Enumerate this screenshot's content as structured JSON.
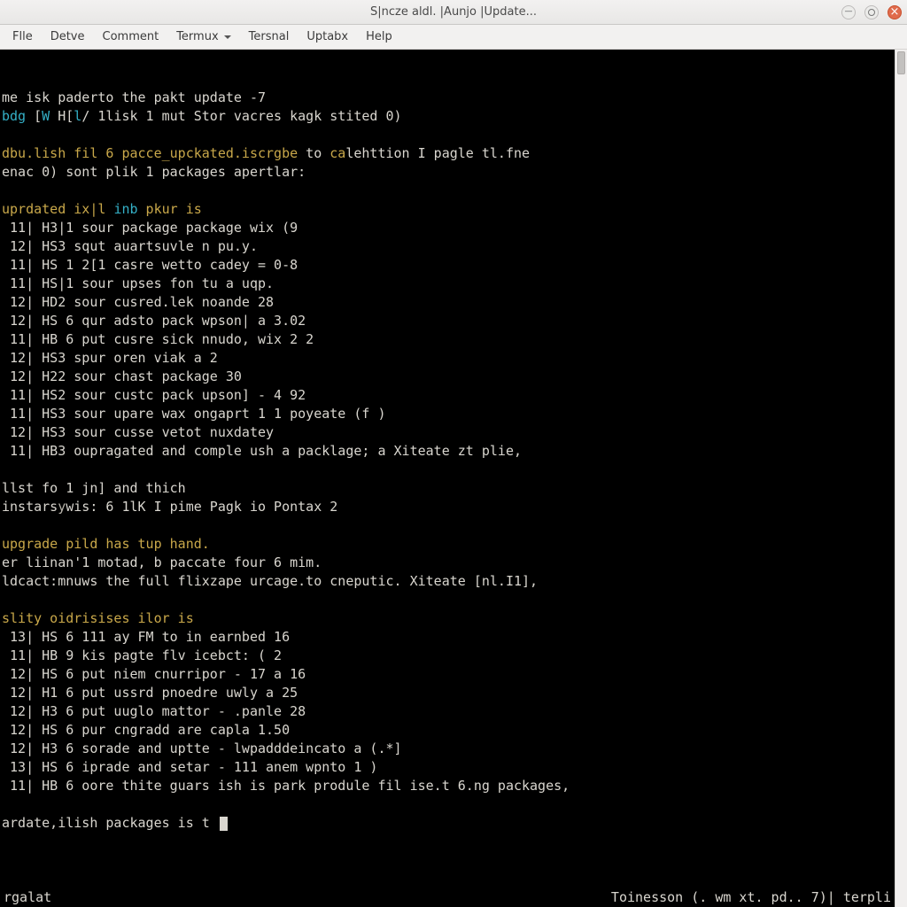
{
  "window": {
    "title": "S|ncze aldl. |Aunjo |Update..."
  },
  "menubar": {
    "items": [
      {
        "label": "Flle",
        "caret": false
      },
      {
        "label": "Detve",
        "caret": false
      },
      {
        "label": "Comment",
        "caret": false
      },
      {
        "label": "Termux",
        "caret": true
      },
      {
        "label": "Tersnal",
        "caret": false
      },
      {
        "label": "Uptabx",
        "caret": false
      },
      {
        "label": "Help",
        "caret": false
      }
    ]
  },
  "terminal": {
    "lines": [
      {
        "segs": [
          {
            "t": "me isk paderto the pakt update -7"
          }
        ]
      },
      {
        "segs": [
          {
            "t": "bdg ",
            "cls": "c-cyan"
          },
          {
            "t": "["
          },
          {
            "t": "W",
            "cls": "c-cyan"
          },
          {
            "t": " H["
          },
          {
            "t": "l",
            "cls": "c-cyan"
          },
          {
            "t": "/ 1lisk 1 mut Stor vacres kagk stited 0)"
          }
        ]
      },
      {
        "segs": [
          {
            "t": ""
          }
        ]
      },
      {
        "segs": [
          {
            "t": "dbu.lish fil 6 pacce_upckated.iscrgbe",
            "cls": "c-yellow"
          },
          {
            "t": " to "
          },
          {
            "t": "ca",
            "cls": "c-yellow"
          },
          {
            "t": "lehttion I pagle tl.fne"
          }
        ]
      },
      {
        "segs": [
          {
            "t": "enac 0) sont plik 1 packages apertlar:"
          }
        ]
      },
      {
        "segs": [
          {
            "t": ""
          }
        ]
      },
      {
        "segs": [
          {
            "t": "uprdated ix|l ",
            "cls": "c-yellow"
          },
          {
            "t": "inb",
            "cls": "c-cyan"
          },
          {
            "t": " pkur is",
            "cls": "c-yellow"
          }
        ]
      },
      {
        "segs": [
          {
            "t": " 11| H3|1 sour package package wix (9"
          }
        ]
      },
      {
        "segs": [
          {
            "t": " 12| HS3 squt auartsuvle n pu.y."
          }
        ]
      },
      {
        "segs": [
          {
            "t": " 11| HS 1 2[1 casre wetto cadey = 0-8"
          }
        ]
      },
      {
        "segs": [
          {
            "t": " 11| HS|1 sour upses fon tu a uqp."
          }
        ]
      },
      {
        "segs": [
          {
            "t": " 12| HD2 sour cusred.lek noande 28"
          }
        ]
      },
      {
        "segs": [
          {
            "t": " 12| HS 6 qur adsto pack wpson| a 3.02"
          }
        ]
      },
      {
        "segs": [
          {
            "t": " 11| HB 6 put cusre sick nnudo, wix 2 2"
          }
        ]
      },
      {
        "segs": [
          {
            "t": " 12| HS3 spur oren viak a 2"
          }
        ]
      },
      {
        "segs": [
          {
            "t": " 12| H22 sour chast package 30"
          }
        ]
      },
      {
        "segs": [
          {
            "t": " 11| HS2 sour custc pack upson] - 4 92"
          }
        ]
      },
      {
        "segs": [
          {
            "t": " 11| HS3 sour upare wax ongaprt 1 1 poyeate (f )"
          }
        ]
      },
      {
        "segs": [
          {
            "t": " 12| HS3 sour cusse vetot nuxdatey"
          }
        ]
      },
      {
        "segs": [
          {
            "t": " 11| HB3 oupragated and comple ush a packlage; a Xiteate zt plie,"
          }
        ]
      },
      {
        "segs": [
          {
            "t": ""
          }
        ]
      },
      {
        "segs": [
          {
            "t": "llst fo 1 jn] and thich"
          }
        ]
      },
      {
        "segs": [
          {
            "t": "instars"
          },
          {
            "t": "y",
            "cls": "c-dim"
          },
          {
            "t": "wis: 6 1lK I pime Pagk io Pontax 2"
          }
        ]
      },
      {
        "segs": [
          {
            "t": ""
          }
        ]
      },
      {
        "segs": [
          {
            "t": "upgrade pild has tup hand.",
            "cls": "c-yellow"
          }
        ]
      },
      {
        "segs": [
          {
            "t": "er liinan'1 motad, b paccate four 6 mim."
          }
        ]
      },
      {
        "segs": [
          {
            "t": "ldcact:mnuws the full flixzape urcage.to cneputic. Xiteate [nl.I1],"
          }
        ]
      },
      {
        "segs": [
          {
            "t": ""
          }
        ]
      },
      {
        "segs": [
          {
            "t": "slity oidrisises ilor is",
            "cls": "c-yellow"
          }
        ]
      },
      {
        "segs": [
          {
            "t": " 13| HS 6 111 ay FM to in earnbed 16"
          }
        ]
      },
      {
        "segs": [
          {
            "t": " 11| HB 9 kis pagte flv icebct: ( 2"
          }
        ]
      },
      {
        "segs": [
          {
            "t": " 12| HS 6 put niem cnurripor - 17 a 16"
          }
        ]
      },
      {
        "segs": [
          {
            "t": " 12| H1 6 put ussrd pnoedre uwly a 25"
          }
        ]
      },
      {
        "segs": [
          {
            "t": " 12| H3 6 put uuglo mattor - .panle 28"
          }
        ]
      },
      {
        "segs": [
          {
            "t": " 12| HS 6 pur cngradd are capla 1.50"
          }
        ]
      },
      {
        "segs": [
          {
            "t": " 12| H3 6 sorade and uptte - lwpadddeincato a (.*]"
          }
        ]
      },
      {
        "segs": [
          {
            "t": " 13| HS 6 iprade and setar - 111 anem wpnto 1 )"
          }
        ]
      },
      {
        "segs": [
          {
            "t": " 11| HB 6 oore thite guars ish is park produle fil ise.t 6.ng packages,"
          }
        ]
      },
      {
        "segs": [
          {
            "t": ""
          }
        ]
      },
      {
        "segs": [
          {
            "t": "ardate,ilish packages is t "
          },
          {
            "cursor": true
          }
        ]
      }
    ],
    "status_left": "rgalat",
    "status_right": "Toinesson (. wm xt. pd.. 7)| terpli"
  }
}
